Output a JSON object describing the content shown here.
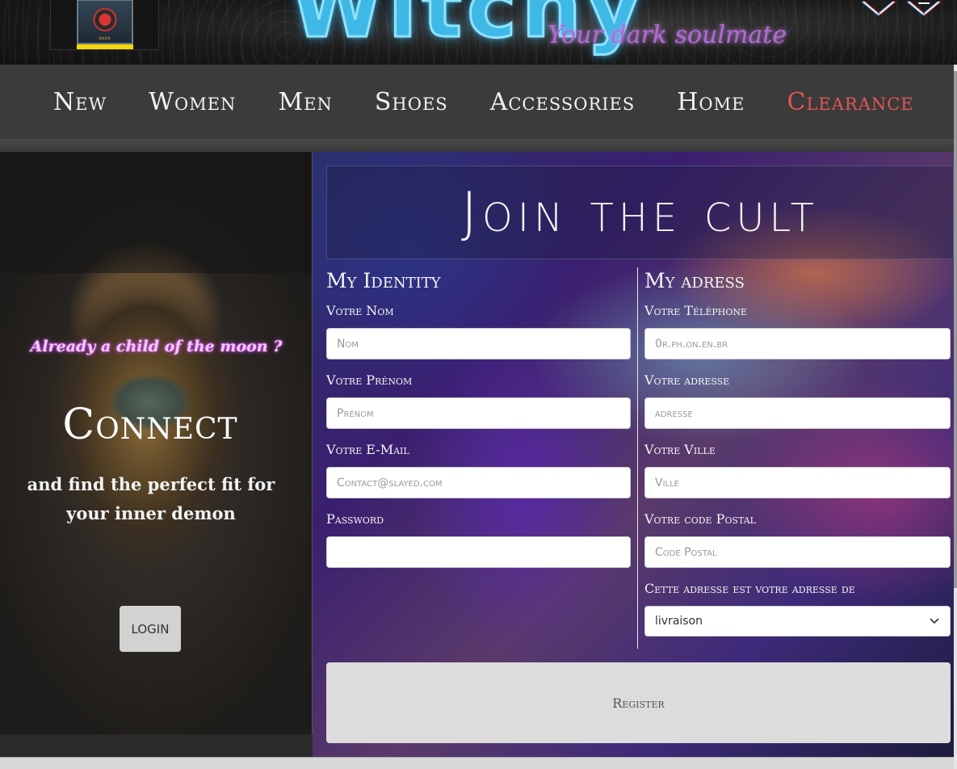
{
  "header": {
    "brand_title": "Witchy",
    "brand_subtitle": "Your dark soulmate",
    "logo_text": "xxxx",
    "icons": [
      "glitch-heart-icon",
      "glitch-crown-icon"
    ]
  },
  "nav": {
    "items": [
      {
        "label": "New"
      },
      {
        "label": "Women"
      },
      {
        "label": "Men"
      },
      {
        "label": "Shoes"
      },
      {
        "label": "Accessories"
      },
      {
        "label": "Home"
      },
      {
        "label": "Clearance",
        "color": "#e25555"
      }
    ]
  },
  "connect": {
    "tagline": "Already a child of the moon ?",
    "title": "Connect",
    "description": "and find the perfect fit for your inner demon",
    "login_label": "LOGIN"
  },
  "form": {
    "title": "Join the cult",
    "identity": {
      "heading": "My Identity",
      "nom_label": "Votre Nom",
      "nom_placeholder": "Nom",
      "prenom_label": "Votre Prénom",
      "prenom_placeholder": "Prénom",
      "email_label": "Votre E-Mail",
      "email_placeholder": "Contact@slayed.com",
      "password_label": "Password",
      "password_placeholder": ""
    },
    "address": {
      "heading": "My adress",
      "phone_label": "Votre Téléphone",
      "phone_placeholder": "0r.ph.on.en.br",
      "adresse_label": "Votre adresse",
      "adresse_placeholder": "adresse",
      "ville_label": "Votre Ville",
      "ville_placeholder": "Ville",
      "cp_label": "Votre code Postal",
      "cp_placeholder": "Code Postal",
      "type_label": "Cette adresse est votre adresse de",
      "type_selected": "livraison"
    },
    "register_label": "Register"
  },
  "colors": {
    "nav_bg": "#3b3b3b",
    "clearance": "#e25555",
    "brand_neon": "#3fb8e6",
    "subtitle_purple": "#b36ad6"
  }
}
